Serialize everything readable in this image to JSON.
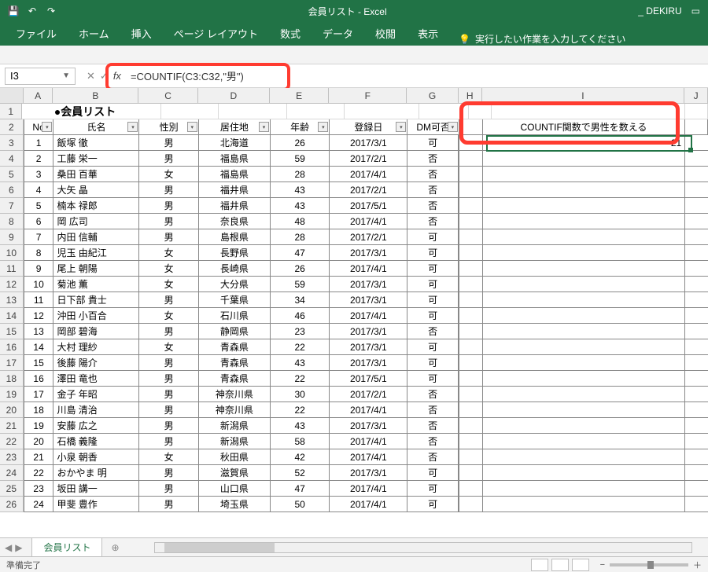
{
  "titlebar": {
    "title": "会員リスト - Excel",
    "user": "_ DEKIRU"
  },
  "ribbon": {
    "tabs": [
      "ファイル",
      "ホーム",
      "挿入",
      "ページ レイアウト",
      "数式",
      "データ",
      "校閲",
      "表示"
    ],
    "tell_me": "実行したい作業を入力してください"
  },
  "formula_bar": {
    "name_box": "I3",
    "formula": "=COUNTIF(C3:C32,\"男\")"
  },
  "columns": [
    "A",
    "B",
    "C",
    "D",
    "E",
    "F",
    "G",
    "H",
    "I",
    "J"
  ],
  "sheet": {
    "title": "●会員リスト",
    "headers": [
      "No",
      "氏名",
      "性別",
      "居住地",
      "年齢",
      "登録日",
      "DM可否"
    ],
    "rows": [
      {
        "no": "1",
        "name": "飯塚 徹",
        "sex": "男",
        "area": "北海道",
        "age": "26",
        "date": "2017/3/1",
        "dm": "可"
      },
      {
        "no": "2",
        "name": "工藤 栄一",
        "sex": "男",
        "area": "福島県",
        "age": "59",
        "date": "2017/2/1",
        "dm": "否"
      },
      {
        "no": "3",
        "name": "桑田 百華",
        "sex": "女",
        "area": "福島県",
        "age": "28",
        "date": "2017/4/1",
        "dm": "否"
      },
      {
        "no": "4",
        "name": "大矢 晶",
        "sex": "男",
        "area": "福井県",
        "age": "43",
        "date": "2017/2/1",
        "dm": "否"
      },
      {
        "no": "5",
        "name": "楠本 禄郎",
        "sex": "男",
        "area": "福井県",
        "age": "43",
        "date": "2017/5/1",
        "dm": "否"
      },
      {
        "no": "6",
        "name": "岡 広司",
        "sex": "男",
        "area": "奈良県",
        "age": "48",
        "date": "2017/4/1",
        "dm": "否"
      },
      {
        "no": "7",
        "name": "内田 信輔",
        "sex": "男",
        "area": "島根県",
        "age": "28",
        "date": "2017/2/1",
        "dm": "可"
      },
      {
        "no": "8",
        "name": "児玉 由紀江",
        "sex": "女",
        "area": "長野県",
        "age": "47",
        "date": "2017/3/1",
        "dm": "可"
      },
      {
        "no": "9",
        "name": "尾上 朝陽",
        "sex": "女",
        "area": "長崎県",
        "age": "26",
        "date": "2017/4/1",
        "dm": "可"
      },
      {
        "no": "10",
        "name": "菊池 薫",
        "sex": "女",
        "area": "大分県",
        "age": "59",
        "date": "2017/3/1",
        "dm": "可"
      },
      {
        "no": "11",
        "name": "日下部 貴士",
        "sex": "男",
        "area": "千葉県",
        "age": "34",
        "date": "2017/3/1",
        "dm": "可"
      },
      {
        "no": "12",
        "name": "沖田 小百合",
        "sex": "女",
        "area": "石川県",
        "age": "46",
        "date": "2017/4/1",
        "dm": "可"
      },
      {
        "no": "13",
        "name": "岡部 碧海",
        "sex": "男",
        "area": "静岡県",
        "age": "23",
        "date": "2017/3/1",
        "dm": "否"
      },
      {
        "no": "14",
        "name": "大村 理紗",
        "sex": "女",
        "area": "青森県",
        "age": "22",
        "date": "2017/3/1",
        "dm": "可"
      },
      {
        "no": "15",
        "name": "後藤 陽介",
        "sex": "男",
        "area": "青森県",
        "age": "43",
        "date": "2017/3/1",
        "dm": "可"
      },
      {
        "no": "16",
        "name": "澤田 竜也",
        "sex": "男",
        "area": "青森県",
        "age": "22",
        "date": "2017/5/1",
        "dm": "可"
      },
      {
        "no": "17",
        "name": "金子 年昭",
        "sex": "男",
        "area": "神奈川県",
        "age": "30",
        "date": "2017/2/1",
        "dm": "否"
      },
      {
        "no": "18",
        "name": "川島 清治",
        "sex": "男",
        "area": "神奈川県",
        "age": "22",
        "date": "2017/4/1",
        "dm": "否"
      },
      {
        "no": "19",
        "name": "安藤 広之",
        "sex": "男",
        "area": "新潟県",
        "age": "43",
        "date": "2017/3/1",
        "dm": "否"
      },
      {
        "no": "20",
        "name": "石橋 義隆",
        "sex": "男",
        "area": "新潟県",
        "age": "58",
        "date": "2017/4/1",
        "dm": "否"
      },
      {
        "no": "21",
        "name": "小泉 朝香",
        "sex": "女",
        "area": "秋田県",
        "age": "42",
        "date": "2017/4/1",
        "dm": "否"
      },
      {
        "no": "22",
        "name": "おかやま 明",
        "sex": "男",
        "area": "滋賀県",
        "age": "52",
        "date": "2017/3/1",
        "dm": "可"
      },
      {
        "no": "23",
        "name": "坂田 講一",
        "sex": "男",
        "area": "山口県",
        "age": "47",
        "date": "2017/4/1",
        "dm": "可"
      },
      {
        "no": "24",
        "name": "甲斐 豊作",
        "sex": "男",
        "area": "埼玉県",
        "age": "50",
        "date": "2017/4/1",
        "dm": "可"
      }
    ],
    "side": {
      "header": "COUNTIF関数で男性を数える",
      "value": "21"
    }
  },
  "sheet_tab": {
    "name": "会員リスト"
  },
  "status": {
    "ready": "準備完了"
  }
}
